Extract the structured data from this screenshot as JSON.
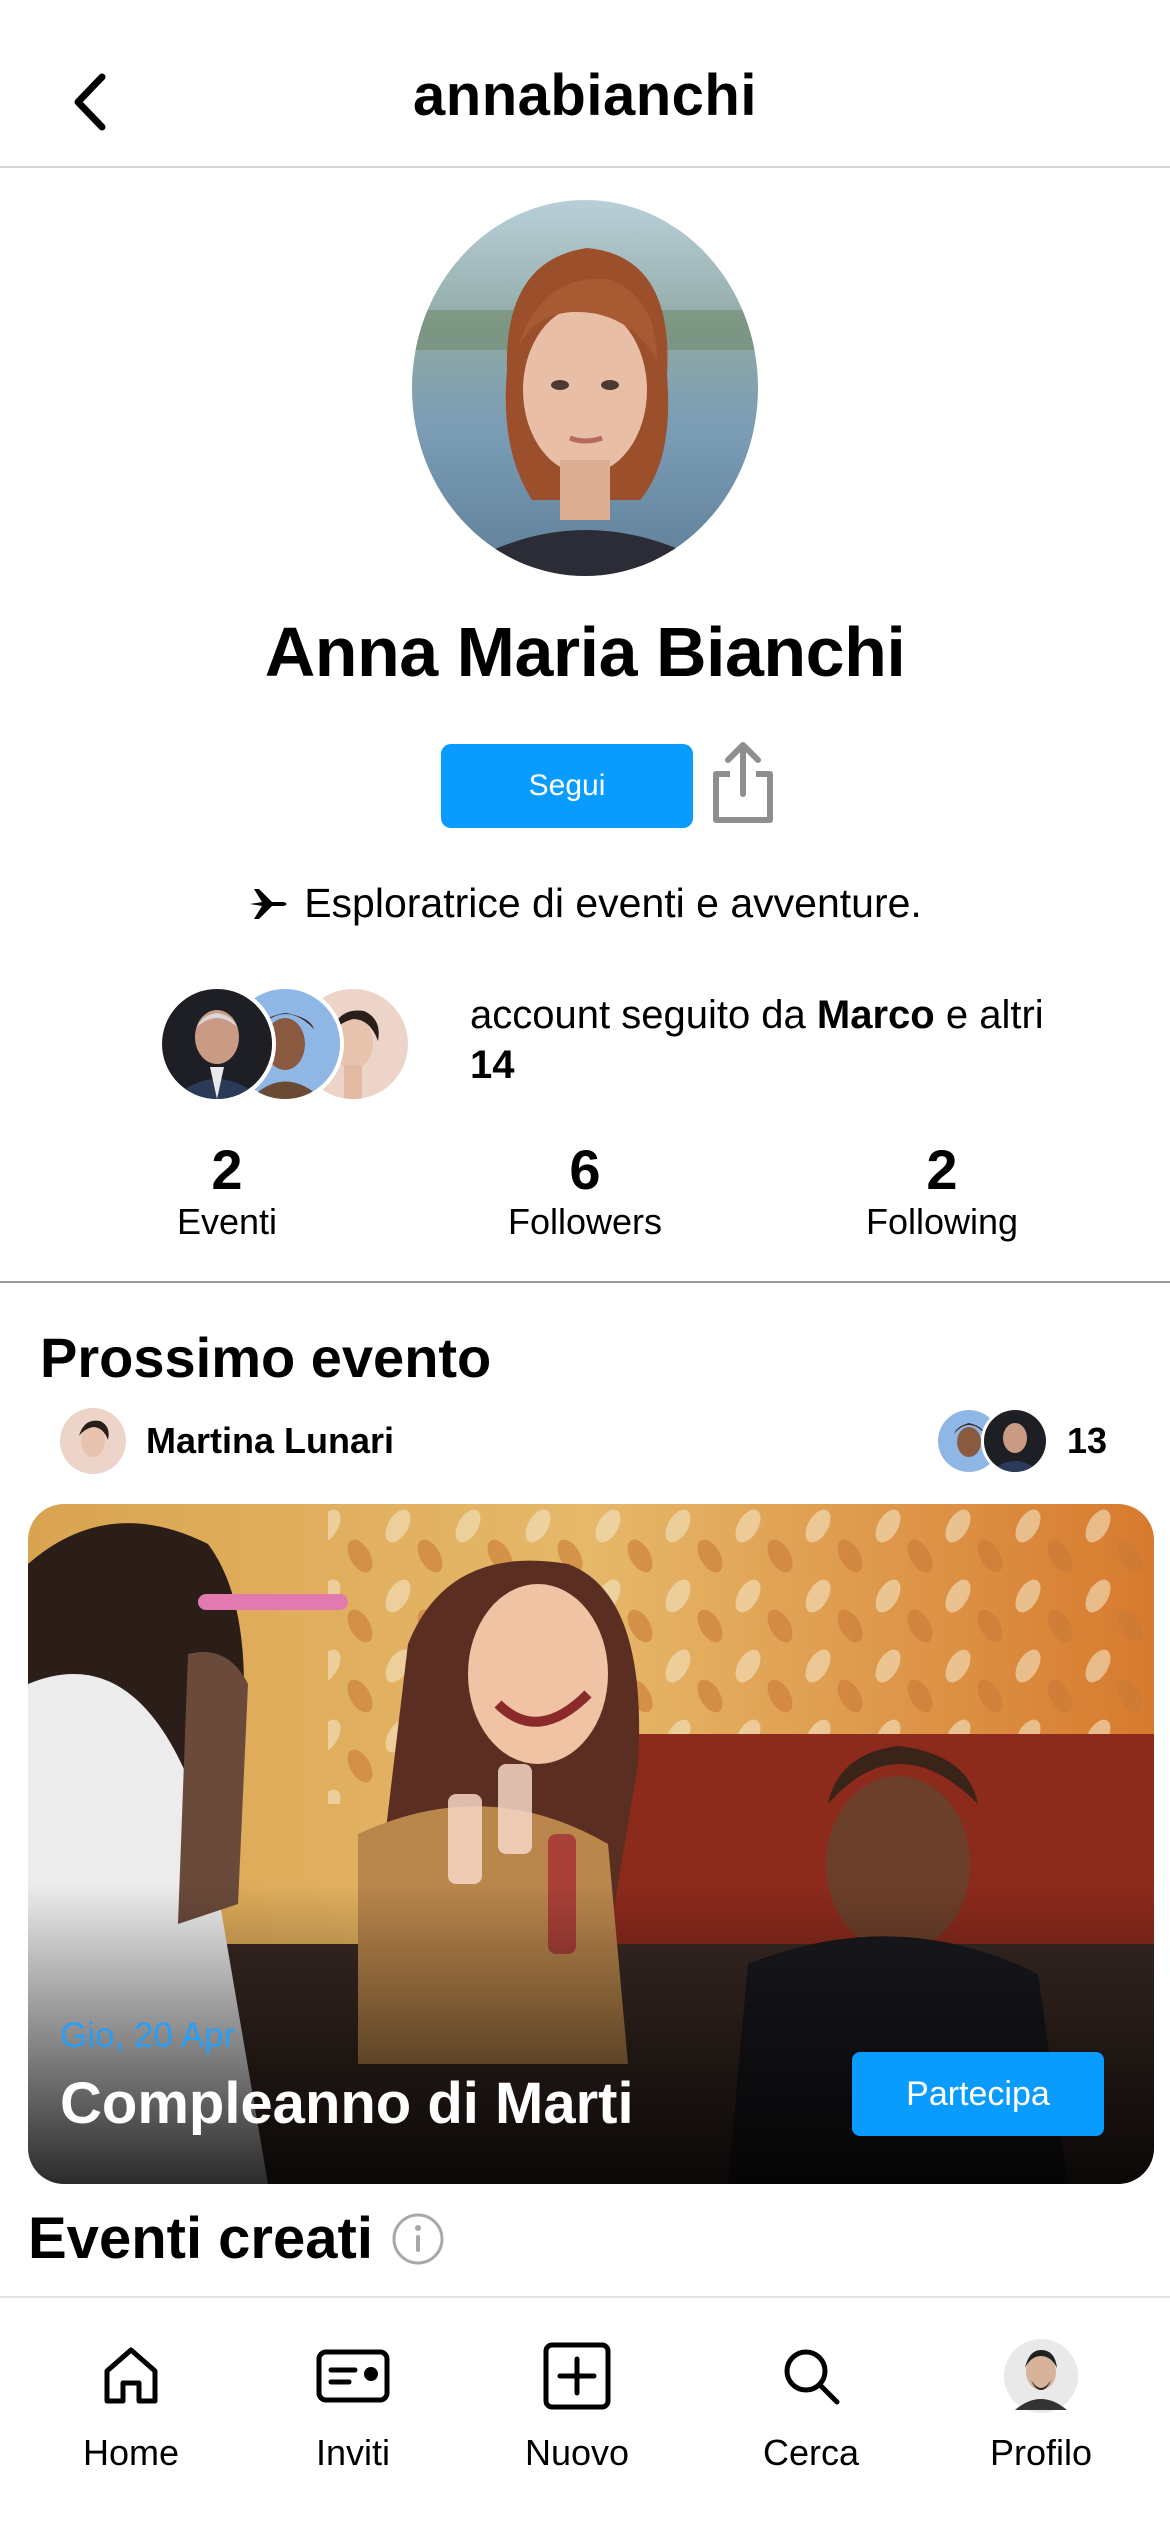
{
  "header": {
    "title": "annabianchi",
    "back_icon": "chevron-left-icon"
  },
  "profile": {
    "name": "Anna Maria Bianchi",
    "follow_label": "Segui",
    "share_icon": "share-icon",
    "bio_icon": "airplane-icon",
    "bio": "Esploratrice di eventi e avventure.",
    "followed_by_prefix": "account seguito da ",
    "followed_by_name": "Marco",
    "followed_by_mid": " e altri ",
    "followed_by_count": "14"
  },
  "stats": [
    {
      "value": "2",
      "label": "Eventi"
    },
    {
      "value": "6",
      "label": "Followers"
    },
    {
      "value": "2",
      "label": "Following"
    }
  ],
  "next_event": {
    "section_title": "Prossimo evento",
    "host_name": "Martina Lunari",
    "guest_count": "13",
    "date": "Gio, 20 Apr",
    "title": "Compleanno di Marti",
    "join_label": "Partecipa"
  },
  "created_events": {
    "title": "Eventi creati",
    "info_icon": "info-icon"
  },
  "tabbar": [
    {
      "label": "Home",
      "icon": "home-icon"
    },
    {
      "label": "Inviti",
      "icon": "ticket-icon"
    },
    {
      "label": "Nuovo",
      "icon": "plus-square-icon"
    },
    {
      "label": "Cerca",
      "icon": "search-icon"
    },
    {
      "label": "Profilo",
      "icon": "avatar"
    }
  ],
  "colors": {
    "accent": "#0a9bff",
    "date_blue": "#2a9df4",
    "text": "#000000"
  }
}
